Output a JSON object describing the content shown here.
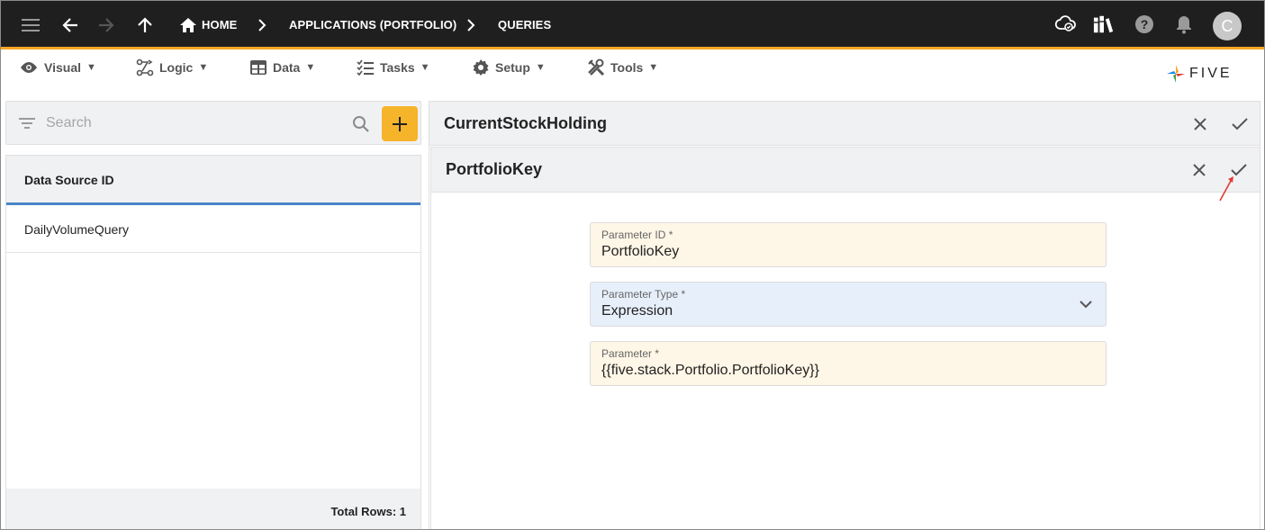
{
  "topbar": {
    "breadcrumbs": [
      "HOME",
      "APPLICATIONS (PORTFOLIO)",
      "QUERIES"
    ],
    "avatar_initial": "C",
    "accent_color": "#f5a623"
  },
  "menu": {
    "items": [
      {
        "label": "Visual",
        "icon": "eye-icon"
      },
      {
        "label": "Logic",
        "icon": "logic-icon"
      },
      {
        "label": "Data",
        "icon": "table-icon"
      },
      {
        "label": "Tasks",
        "icon": "tasks-icon"
      },
      {
        "label": "Setup",
        "icon": "gear-icon"
      },
      {
        "label": "Tools",
        "icon": "tools-icon"
      }
    ],
    "caret": "▼"
  },
  "logo": {
    "text": "FIVE"
  },
  "sidebar": {
    "search_placeholder": "Search",
    "column_header": "Data Source ID",
    "rows": [
      "DailyVolumeQuery"
    ],
    "total_rows": "Total Rows: 1"
  },
  "main": {
    "outer_title": "CurrentStockHolding",
    "inner_title": "PortfolioKey",
    "fields": [
      {
        "label": "Parameter ID *",
        "value": "PortfolioKey"
      },
      {
        "label": "Parameter Type *",
        "value": "Expression"
      },
      {
        "label": "Parameter *",
        "value": "{{five.stack.Portfolio.PortfolioKey}}"
      }
    ]
  }
}
